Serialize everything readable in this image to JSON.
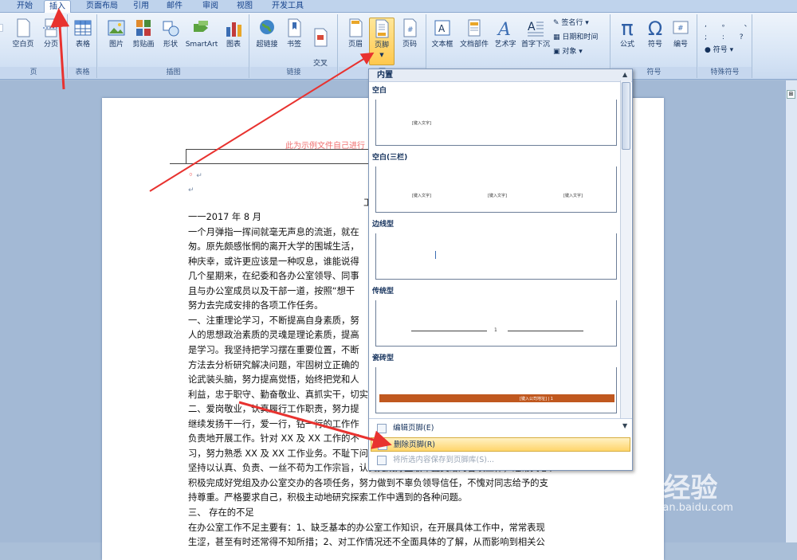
{
  "tabs": [
    "开始",
    "插入",
    "页面布局",
    "引用",
    "邮件",
    "审阅",
    "视图",
    "开发工具"
  ],
  "active_tab": "插入",
  "ribbon": {
    "groups": {
      "pages": "页",
      "tables": "表格",
      "illustrations": "插图",
      "links": "链接",
      "header_footer": "页",
      "symbols": "符号",
      "special": "特殊符号"
    },
    "buttons": {
      "blank_page": "空白页",
      "page_break": "分页",
      "table": "表格",
      "picture": "图片",
      "clipart": "剪贴画",
      "shapes": "形状",
      "smartart": "SmartArt",
      "chart": "图表",
      "hyperlink": "超链接",
      "bookmark": "书签",
      "crossref": "交叉\n引用",
      "header": "页眉",
      "footer": "页脚",
      "page_number": "页码",
      "textbox": "文本框",
      "quickparts": "文档部件",
      "wordart": "艺术字",
      "dropcap": "首字下沉",
      "signature": "签名行",
      "datetime": "日期和时间",
      "object": "对象",
      "equation": "公式",
      "symbol": "符号",
      "number": "编号",
      "special_symbol": "符号"
    }
  },
  "document": {
    "header_note": "此为示例文件自己进行",
    "title_fragment": "工",
    "lines": [
      "一一2017 年 8 月",
      "一个月弹指一挥间就毫无声息的流逝，就在",
      "匆。原先颇感怅惘的离开大学的围城生活，",
      "种庆幸，或许更应该是一种叹息，谁能说得",
      "几个星期来，在纪委和各办公室领导、同事",
      "且与办公室成员以及干部一道，按照“想干",
      "努力去完成安排的各项工作任务。",
      "一、注重理论学习，不断提高自身素质，努",
      "人的思想政治素质的灵魂是理论素质，提高",
      "是学习。我坚持把学习摆在重要位置，不断",
      "方法去分析研究解决问题，牢固树立正确的",
      "论武装头脑，努力提高觉悟，始终把党和人",
      "利益，忠于职守、勤奋敬业、真抓实干，切实",
      "二、爱岗敬业，认真履行工作职责，努力提",
      "继续发扬干一行，爱一行，钻一行的工作作",
      "负责地开展工作。针对 XX 及 XX 工作的不",
      "习，努力熟悉 XX 及 XX 工作业务。不耻下问",
      "坚持以认真、负责、一丝不苟为工作宗旨，认真完成好主级布置交给的各项工作，经常关心、",
      "积极完成好党组及办公室交办的各项任务，努力做到不辜负领导信任，不愧对同志给予的支",
      "持尊重。严格要求自己，积极主动地研究探索工作中遇到的各种问题。",
      "三、  存在的不足",
      "在办公室工作不足主要有：1、缺乏基本的办公室工作知识，在开展具体工作中，常常表现",
      "生涩，甚至有时还常得不知所措；2、对工作情况还不全面具体的了解，从而影响到相关公"
    ]
  },
  "gallery": {
    "heading": "内置",
    "sections": [
      "空白",
      "空白(三栏)",
      "边线型",
      "传统型",
      "瓷砖型"
    ],
    "placeholder": "[键入文字]",
    "traditional_num": "1",
    "tile_text": "[键入公司地址]  |  1",
    "menu": {
      "edit": "编辑页脚(E)",
      "delete": "删除页脚(R)",
      "save": "将所选内容保存到页脚库(S)..."
    }
  },
  "watermark": {
    "brand": "Bai 经验",
    "url": "jingyan.baidu.com"
  },
  "colors": {
    "accent_arrow": "#e8322f",
    "tab_active": "#ffffff",
    "highlight": "#ffd56b"
  }
}
